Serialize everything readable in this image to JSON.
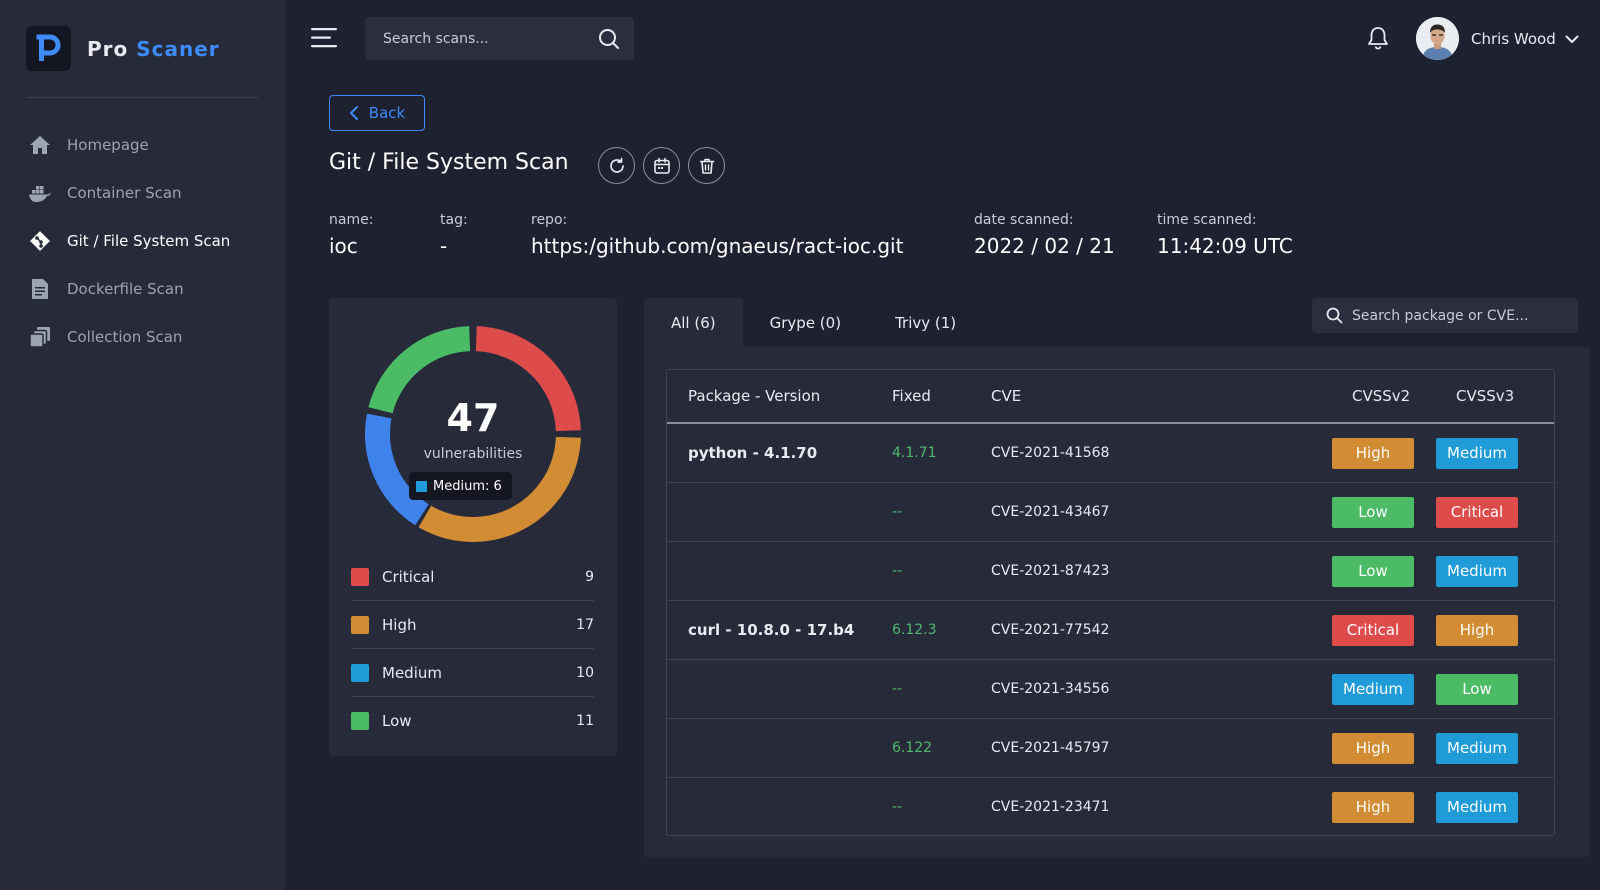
{
  "app": {
    "brand_prefix": "Pro",
    "brand_accent": "Scaner"
  },
  "sidebar": {
    "items": [
      {
        "label": "Homepage",
        "icon": "home-icon",
        "active": false
      },
      {
        "label": "Container Scan",
        "icon": "docker-icon",
        "active": false
      },
      {
        "label": "Git / File System Scan",
        "icon": "git-icon",
        "active": true
      },
      {
        "label": "Dockerfile Scan",
        "icon": "file-icon",
        "active": false
      },
      {
        "label": "Collection Scan",
        "icon": "collection-icon",
        "active": false
      }
    ]
  },
  "topbar": {
    "search_placeholder": "Search scans...",
    "user_name": "Chris Wood"
  },
  "page": {
    "back_label": "Back",
    "title": "Git / File System Scan",
    "meta": {
      "name_label": "name:",
      "name_value": "ioc",
      "tag_label": "tag:",
      "tag_value": "-",
      "repo_label": "repo:",
      "repo_value": "https:/github.com/gnaeus/ract-ioc.git",
      "date_label": "date scanned:",
      "date_value": "2022 / 02 / 21",
      "time_label": "time scanned:",
      "time_value": "11:42:09 UTC"
    }
  },
  "summary": {
    "total": "47",
    "total_label": "vulnerabilities",
    "tooltip": "Medium: 6",
    "legend": [
      {
        "label": "Critical",
        "count": "9",
        "color": "#dd4b4b"
      },
      {
        "label": "High",
        "count": "17",
        "color": "#d28c33"
      },
      {
        "label": "Medium",
        "count": "10",
        "color": "#1f9bd8"
      },
      {
        "label": "Low",
        "count": "11",
        "color": "#4cbb65"
      }
    ],
    "donut_colors": {
      "critical": "#dd4b4b",
      "high": "#d28c33",
      "medium": "#3e82ea",
      "low": "#4cbb65"
    }
  },
  "tabs": [
    {
      "label": "All (6)",
      "active": true
    },
    {
      "label": "Grype (0)",
      "active": false
    },
    {
      "label": "Trivy (1)",
      "active": false
    }
  ],
  "table": {
    "search_placeholder": "Search package or CVE...",
    "headers": {
      "package": "Package - Version",
      "fixed": "Fixed",
      "cve": "CVE",
      "cvss2": "CVSSv2",
      "cvss3": "CVSSv3"
    },
    "rows": [
      {
        "package": "python - 4.1.70",
        "fixed": "4.1.71",
        "cve": "CVE-2021-41568",
        "cvss2": "High",
        "cvss3": "Medium"
      },
      {
        "package": "",
        "fixed": "--",
        "cve": "CVE-2021-43467",
        "cvss2": "Low",
        "cvss3": "Critical"
      },
      {
        "package": "",
        "fixed": "--",
        "cve": "CVE-2021-87423",
        "cvss2": "Low",
        "cvss3": "Medium"
      },
      {
        "package": "curl - 10.8.0 - 17.b4",
        "fixed": "6.12.3",
        "cve": "CVE-2021-77542",
        "cvss2": "Critical",
        "cvss3": "High"
      },
      {
        "package": "",
        "fixed": "--",
        "cve": "CVE-2021-34556",
        "cvss2": "Medium",
        "cvss3": "Low"
      },
      {
        "package": "",
        "fixed": "6.122",
        "cve": "CVE-2021-45797",
        "cvss2": "High",
        "cvss3": "Medium"
      },
      {
        "package": "",
        "fixed": "--",
        "cve": "CVE-2021-23471",
        "cvss2": "High",
        "cvss3": "Medium"
      }
    ],
    "severity_colors": {
      "Critical": "#dd4b4b",
      "High": "#d28c33",
      "Medium": "#1f9bd8",
      "Low": "#4cbb65"
    }
  }
}
